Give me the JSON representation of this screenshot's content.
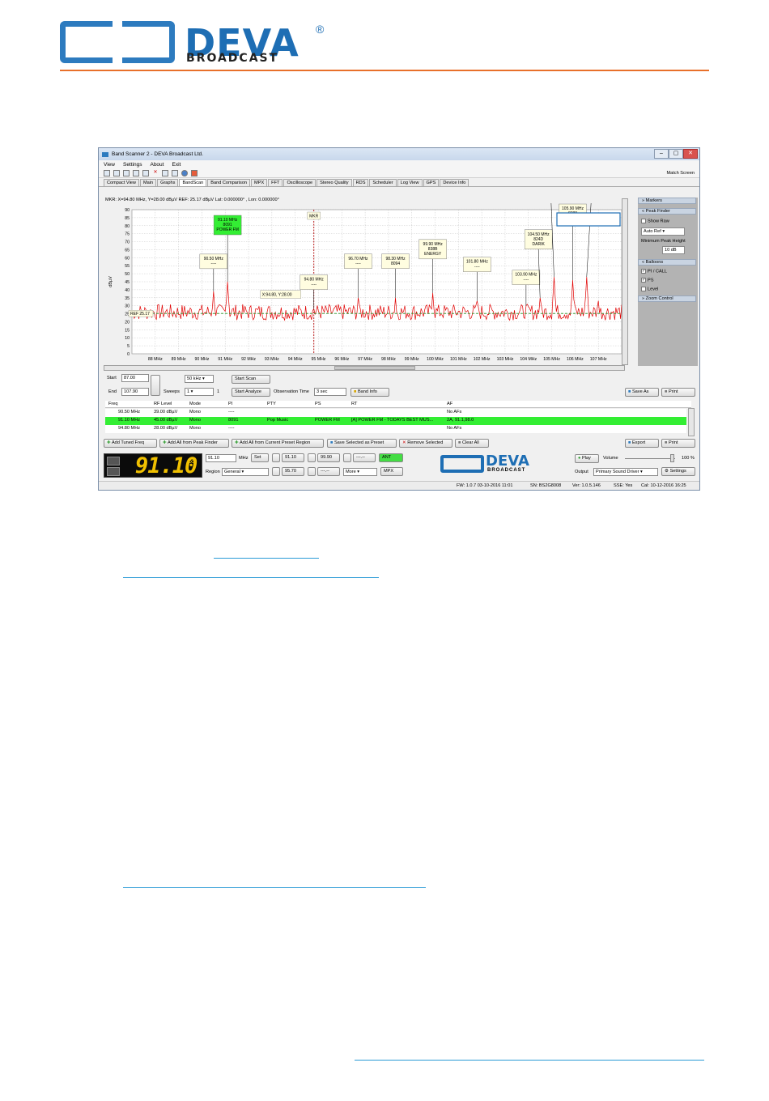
{
  "header": {
    "logo_deva": "DEVA",
    "logo_reg": "®",
    "logo_broadcast": "BROADCAST"
  },
  "window": {
    "title": "Band Scanner 2 - DEVA Broadcast Ltd.",
    "controls": [
      "–",
      "▢",
      "✕"
    ],
    "menu": [
      "View",
      "Settings",
      "About",
      "Exit"
    ],
    "match_screen": "Match Screen",
    "tabs": [
      "Compact View",
      "Main",
      "Graphs",
      "BandScan",
      "Band Comparison",
      "MPX",
      "FFT",
      "Oscilloscope",
      "Stereo Quality",
      "RDS",
      "Scheduler",
      "Log View",
      "GPS",
      "Device Info"
    ],
    "active_tab": "BandScan"
  },
  "chart_info": "MKR: X=94.80 MHz, Y=28.00 dBµV     REF: 25.17 dBµV     Lat: 0.000000° , Lon: 0.000000°",
  "chart_data": {
    "type": "line",
    "ylabel": "dBµV",
    "xlim": [
      87.0,
      108.0
    ],
    "ylim": [
      0,
      90
    ],
    "x_ticks": [
      "88 MHz",
      "89 MHz",
      "90 MHz",
      "91 MHz",
      "92 MHz",
      "93 MHz",
      "94 MHz",
      "95 MHz",
      "96 MHz",
      "97 MHz",
      "98 MHz",
      "99 MHz",
      "100 MHz",
      "101 MHz",
      "102 MHz",
      "103 MHz",
      "104 MHz",
      "105 MHz",
      "106 MHz",
      "107 MHz"
    ],
    "y_ticks": [
      "0",
      "5",
      "10",
      "15",
      "20",
      "25",
      "30",
      "35",
      "40",
      "45",
      "50",
      "55",
      "60",
      "65",
      "70",
      "75",
      "80",
      "85",
      "90"
    ],
    "ref_level": 25.17,
    "ref_label": "REF 25.17",
    "marker": {
      "x": 94.8,
      "label": "MKR",
      "readout": "X:94.80, Y:28.00"
    },
    "peaks": [
      {
        "freq": 90.5,
        "level": 39.0,
        "lines": [
          "90.50 MHz",
          "----"
        ]
      },
      {
        "freq": 91.1,
        "level": 45.0,
        "lines": [
          "91.10 MHz",
          "8091",
          "POWER FM"
        ],
        "highlight": true
      },
      {
        "freq": 94.8,
        "level": 28.0,
        "lines": [
          "94.80 MHz",
          "----"
        ]
      },
      {
        "freq": 96.7,
        "level": 35.0,
        "lines": [
          "96.70 MHz",
          "----"
        ]
      },
      {
        "freq": 98.3,
        "level": 35.0,
        "lines": [
          "98.30 MHz",
          "8094"
        ]
      },
      {
        "freq": 99.9,
        "level": 38.0,
        "lines": [
          "99.90 MHz",
          "838B",
          "ENERGY"
        ]
      },
      {
        "freq": 101.8,
        "level": 33.0,
        "lines": [
          "101.80 MHz",
          "----"
        ]
      },
      {
        "freq": 103.9,
        "level": 30.0,
        "lines": [
          "103.90 MHz",
          "----"
        ]
      },
      {
        "freq": 104.5,
        "level": 35.0,
        "lines": [
          "104.50 MHz",
          "824D",
          "DARIK"
        ]
      },
      {
        "freq": 105.1,
        "level": 48.0,
        "lines": [
          "105.10 MHz",
          "----"
        ]
      },
      {
        "freq": 105.9,
        "level": 46.0,
        "lines": [
          "105.90 MHz",
          "8388",
          "ROCK"
        ]
      },
      {
        "freq": 106.5,
        "level": 48.0,
        "lines": [
          "106.50 MHz",
          "835F",
          "FOCUS"
        ]
      },
      {
        "freq": 107.0,
        "level": 33.0,
        "lines": []
      }
    ]
  },
  "side": {
    "markers": "Markers",
    "peak_finder": "Peak Finder",
    "show_raw": "Show Raw",
    "auto_ref": "Auto Ref",
    "min_peak": "Minimum Peak Height",
    "min_peak_val": "10 dB",
    "balloons": "Balloons",
    "pi_call": "PI / CALL",
    "ps": "PS",
    "level": "Level",
    "zoom": "Zoom Control"
  },
  "controls": {
    "start_lbl": "Start",
    "start_val": "87.00",
    "end_lbl": "End",
    "end_val": "107.90",
    "step_val": "50 kHz",
    "sweeps_lbl": "Sweeps",
    "sweeps_val": "1",
    "sweeps_count": "1",
    "start_scan": "Start Scan",
    "start_analyze": "Start Analyze",
    "obs_lbl": "Observation Time",
    "obs_val": "3 sec",
    "band_info": "Band Info",
    "save_as": "Save As",
    "print": "Print"
  },
  "table": {
    "headers": [
      "Freq",
      "RF Level",
      "Mode",
      "PI",
      "PTY",
      "PS",
      "RT",
      "AF"
    ],
    "rows": [
      [
        "90.50 MHz",
        "39.00 dBµV",
        "Mono",
        "----",
        "",
        "",
        "",
        "No AFs"
      ],
      [
        "91.10 MHz",
        "45.00 dBµV",
        "Mono",
        "8091",
        "Pop Music",
        "POWER FM",
        "[A] POWER FM - TODAYS BEST MUS...",
        "2A, 91.1,98.0"
      ],
      [
        "94.80 MHz",
        "28.00 dBµV",
        "Mono",
        "----",
        "",
        "",
        "",
        "No AFs"
      ]
    ]
  },
  "bottom_buttons": {
    "add_tuned": "Add Tuned Freq",
    "add_peak": "Add All from Peak Finder",
    "add_region": "Add All from Current Preset Region",
    "save_preset": "Save Selected as Preset",
    "remove": "Remove Selected",
    "clear": "Clear All",
    "export": "Export",
    "print": "Print"
  },
  "tuner": {
    "freq_display": "91.10",
    "freq_val": "91.10",
    "mhz": "MHz",
    "set": "Set",
    "p1": "91.10",
    "p2": "99.90",
    "p3": "---.--",
    "ant": "ANT",
    "region_lbl": "Region",
    "region_val": "General",
    "p4": "95.70",
    "p5": "---.--",
    "more": "More",
    "mpx": "MPX",
    "play": "Play",
    "volume_lbl": "Volume",
    "volume_val": "100 %",
    "output_lbl": "Output",
    "output_val": "Primary Sound Driver",
    "settings": "Settings",
    "logo_deva": "DEVA",
    "logo_broadcast": "BROADCAST"
  },
  "status": {
    "fw": "FW: 1.0.7 03-10-2016 11:01",
    "sn": "SN: BS2G8008",
    "ver": "Ver: 1.0.5.146",
    "sse": "SSE: Yes",
    "cal": "Cal: 10-12-2016 16:25"
  },
  "colors": {
    "accent": "#2d7bbf",
    "orange": "#e8702a",
    "highlight": "#33ee33",
    "trace": "#e00000",
    "ref": "#2a9a2a"
  }
}
